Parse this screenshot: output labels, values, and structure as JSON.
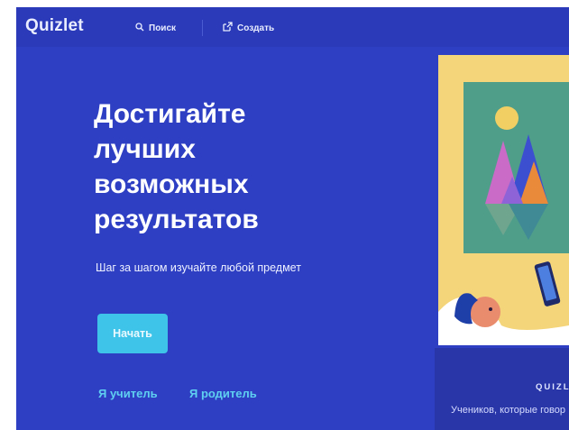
{
  "brand": {
    "logo": "Quizlet"
  },
  "nav": {
    "search_label": "Поиск",
    "create_label": "Создать",
    "search_icon": "search-icon",
    "create_icon": "create-icon"
  },
  "hero": {
    "title_lines": [
      "Достигайте",
      "лучших",
      "возможных",
      "результатов"
    ],
    "subtitle": "Шаг за шагом изучайте любой предмет",
    "start_button": "Начать",
    "teacher_link": "Я учитель",
    "parent_link": "Я родитель"
  },
  "panel": {
    "brand_small": "QUIZL",
    "students_text": "Учеников, которые говор"
  },
  "colors": {
    "background": "#2e3fc4",
    "button": "#3ec4e8",
    "link": "#5fd0f0",
    "illustration_bg": "#f4d57a",
    "frame_green": "#4e9e8a"
  }
}
